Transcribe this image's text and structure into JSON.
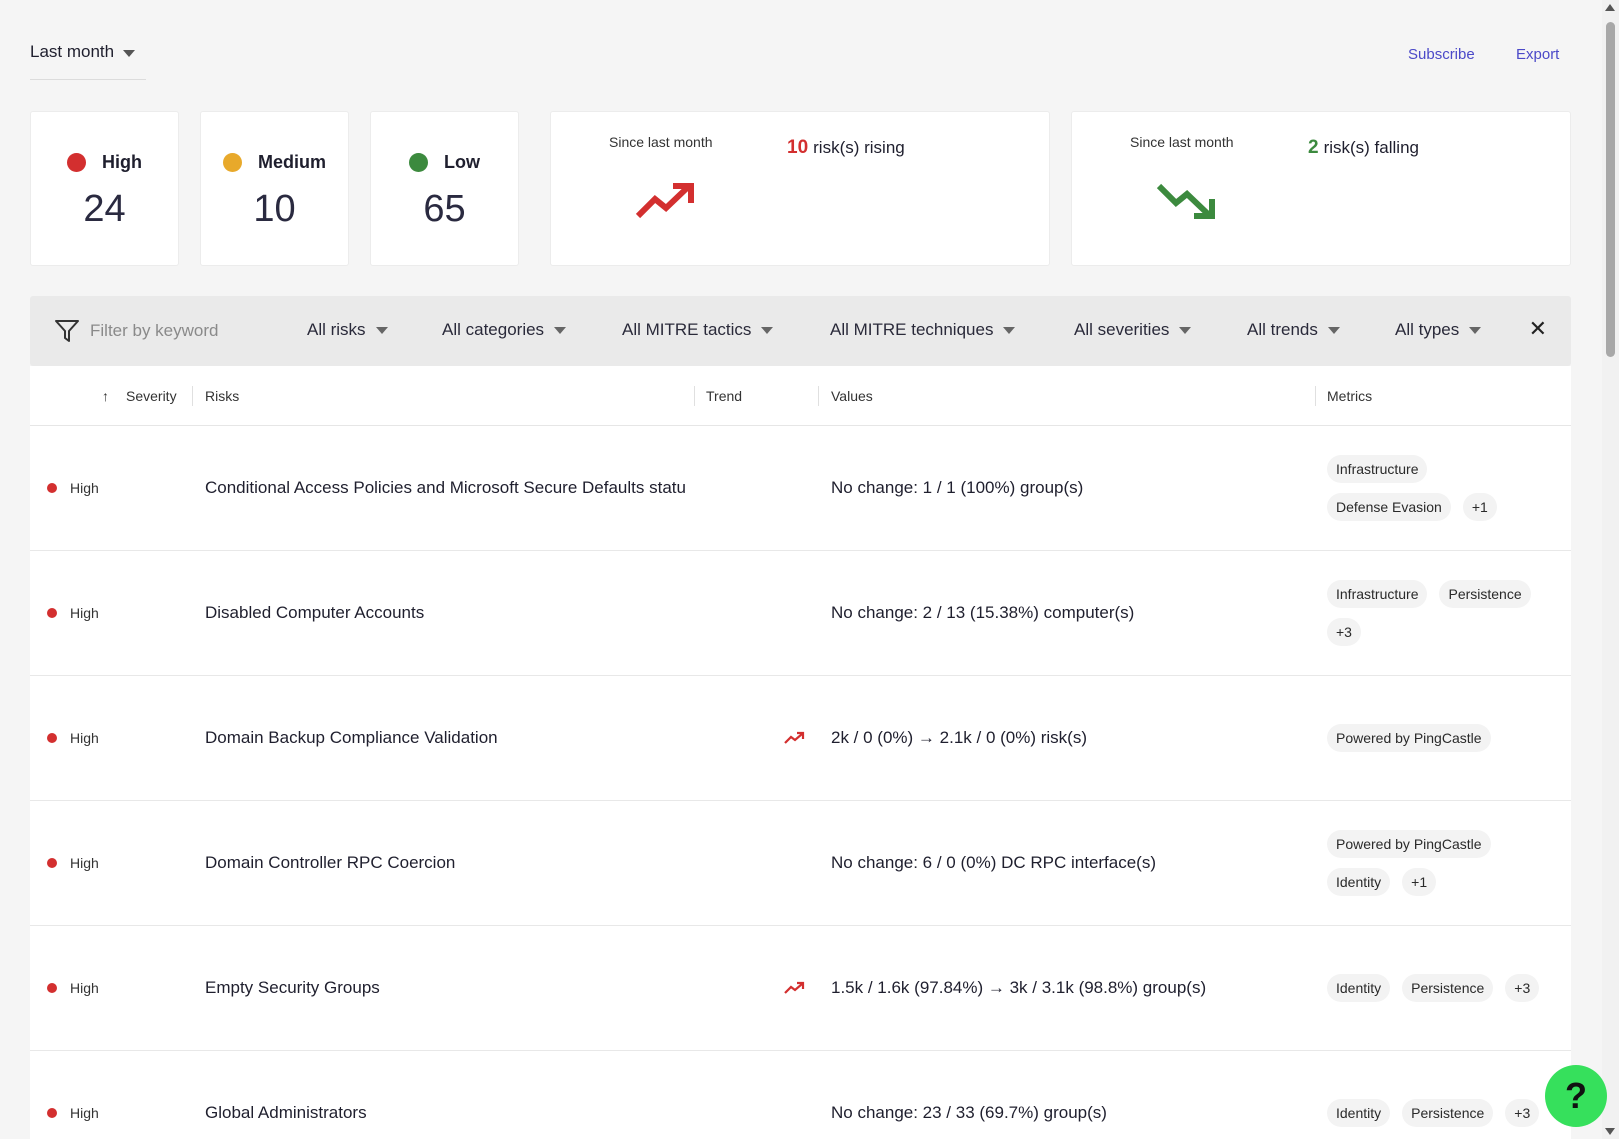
{
  "header": {
    "period": "Last month",
    "subscribe_label": "Subscribe",
    "export_label": "Export"
  },
  "summary": {
    "severities": [
      {
        "label": "High",
        "count": "24",
        "color": "#d32f2f"
      },
      {
        "label": "Medium",
        "count": "10",
        "color": "#e8a92b"
      },
      {
        "label": "Low",
        "count": "65",
        "color": "#3c8a3e"
      }
    ],
    "rising": {
      "since": "Since last month",
      "count": "10",
      "text": "risk(s) rising",
      "color": "#d32f2f"
    },
    "falling": {
      "since": "Since last month",
      "count": "2",
      "text": "risk(s) falling",
      "color": "#3c8a3e"
    }
  },
  "filters": {
    "search_placeholder": "Filter by keyword",
    "dropdowns": [
      "All risks",
      "All categories",
      "All MITRE tactics",
      "All MITRE techniques",
      "All severities",
      "All trends",
      "All types"
    ],
    "clear_icon": "close-icon"
  },
  "table": {
    "headers": {
      "severity": "Severity",
      "risks": "Risks",
      "trend": "Trend",
      "values": "Values",
      "metrics": "Metrics"
    },
    "rows": [
      {
        "severity": "High",
        "risk": "Conditional Access Policies and Microsoft Secure Defaults status",
        "trend": "",
        "value": "No change: 1 / 1 (100%) group(s)",
        "metrics": [
          [
            "Infrastructure"
          ],
          [
            "Defense Evasion",
            "+1"
          ]
        ]
      },
      {
        "severity": "High",
        "risk": "Disabled Computer Accounts",
        "trend": "",
        "value": "No change: 2 / 13 (15.38%) computer(s)",
        "metrics": [
          [
            "Infrastructure",
            "Persistence"
          ],
          [
            "+3"
          ]
        ]
      },
      {
        "severity": "High",
        "risk": "Domain Backup Compliance Validation",
        "trend": "rising",
        "value": "2k / 0 (0%) → 2.1k / 0 (0%) risk(s)",
        "metrics": [
          [
            "Powered by PingCastle"
          ]
        ]
      },
      {
        "severity": "High",
        "risk": "Domain Controller RPC Coercion",
        "trend": "",
        "value": "No change: 6 / 0 (0%) DC RPC interface(s)",
        "metrics": [
          [
            "Powered by PingCastle"
          ],
          [
            "Identity",
            "+1"
          ]
        ]
      },
      {
        "severity": "High",
        "risk": "Empty Security Groups",
        "trend": "rising",
        "value": "1.5k / 1.6k (97.84%) → 3k / 3.1k (98.8%) group(s)",
        "metrics": [
          [
            "Identity",
            "Persistence",
            "+3"
          ]
        ]
      },
      {
        "severity": "High",
        "risk": "Global Administrators",
        "trend": "",
        "value": "No change: 23 / 33 (69.7%) group(s)",
        "metrics": [
          [
            "Identity",
            "Persistence",
            "+3"
          ]
        ]
      }
    ]
  },
  "help_label": "?",
  "colors": {
    "accent": "#4b49c8",
    "high": "#d32f2f",
    "help": "#36e05c"
  }
}
